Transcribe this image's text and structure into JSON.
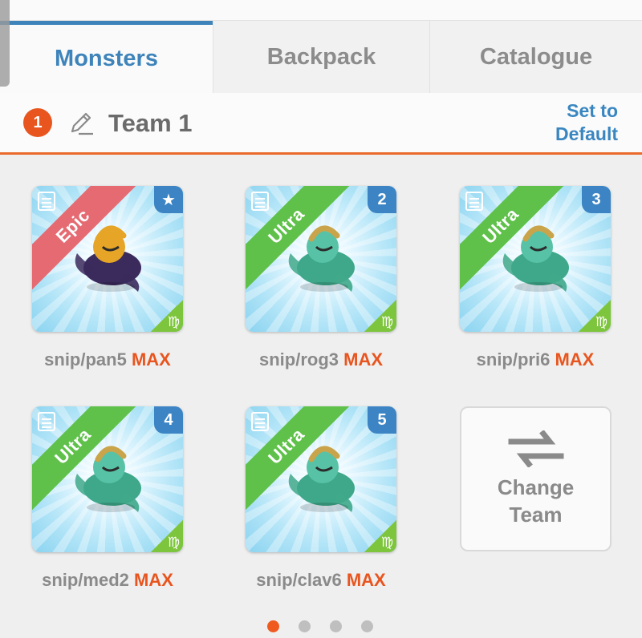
{
  "tabs": [
    {
      "label": "Monsters",
      "active": true
    },
    {
      "label": "Backpack",
      "active": false
    },
    {
      "label": "Catalogue",
      "active": false
    }
  ],
  "team": {
    "number": "1",
    "name": "Team 1",
    "set_default_line1": "Set to",
    "set_default_line2": "Default",
    "icon": "pencil-icon"
  },
  "monsters": [
    {
      "rarity": "Epic",
      "slot_marker": "★",
      "zodiac": "♍",
      "name": "snip/pan5",
      "level": "MAX"
    },
    {
      "rarity": "Ultra",
      "slot_marker": "2",
      "zodiac": "♍",
      "name": "snip/rog3",
      "level": "MAX"
    },
    {
      "rarity": "Ultra",
      "slot_marker": "3",
      "zodiac": "♍",
      "name": "snip/pri6",
      "level": "MAX"
    },
    {
      "rarity": "Ultra",
      "slot_marker": "4",
      "zodiac": "♍",
      "name": "snip/med2",
      "level": "MAX"
    },
    {
      "rarity": "Ultra",
      "slot_marker": "5",
      "zodiac": "♍",
      "name": "snip/clav6",
      "level": "MAX"
    }
  ],
  "change_team": {
    "line1": "Change",
    "line2": "Team",
    "icon": "swap-arrows-icon"
  },
  "pager": {
    "pages": 4,
    "current": 1
  },
  "colors": {
    "accent_blue": "#3e84bb",
    "accent_orange": "#e8551f",
    "ultra_green": "#5fc14a",
    "epic_red": "#e56a72"
  }
}
